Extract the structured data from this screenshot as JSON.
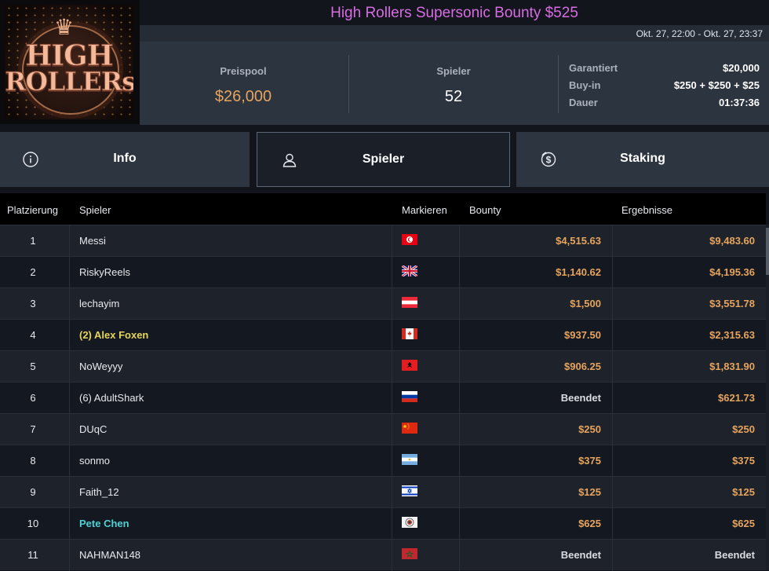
{
  "logo": {
    "line1": "HIGH",
    "line2": "ROLLERs"
  },
  "tournament": {
    "title": "High Rollers Supersonic Bounty $525",
    "dates": "Okt. 27, 22:00 - Okt. 27, 23:37"
  },
  "stats": {
    "pool_label": "Preispool",
    "pool_value": "$26,000",
    "players_label": "Spieler",
    "players_value": "52",
    "info": [
      {
        "key": "Garantiert",
        "value": "$20,000"
      },
      {
        "key": "Buy-in",
        "value": "$250 + $250 + $25"
      },
      {
        "key": "Dauer",
        "value": "01:37:36"
      }
    ]
  },
  "tabs": [
    {
      "label": "Info",
      "icon": "info-icon",
      "active": false
    },
    {
      "label": "Spieler",
      "icon": "user-icon",
      "active": true
    },
    {
      "label": "Staking",
      "icon": "dollar-coin-icon",
      "active": false
    }
  ],
  "table": {
    "headers": {
      "rank": "Platzierung",
      "player": "Spieler",
      "flag": "Markieren",
      "bounty": "Bounty",
      "result": "Ergebnisse"
    },
    "rows": [
      {
        "rank": "1",
        "player": "Messi",
        "flag": "tunisia",
        "bounty": "$4,515.63",
        "result": "$9,483.60"
      },
      {
        "rank": "2",
        "player": "RiskyReels",
        "flag": "uk",
        "bounty": "$1,140.62",
        "result": "$4,195.36"
      },
      {
        "rank": "3",
        "player": "lechayim",
        "flag": "austria",
        "bounty": "$1,500",
        "result": "$3,551.78"
      },
      {
        "rank": "4",
        "player": "(2) Alex Foxen",
        "flag": "canada",
        "bounty": "$937.50",
        "result": "$2,315.63",
        "highlight": "yellow"
      },
      {
        "rank": "5",
        "player": "NoWeyyy",
        "flag": "albania",
        "bounty": "$906.25",
        "result": "$1,831.90"
      },
      {
        "rank": "6",
        "player": "(6) AdultShark",
        "flag": "russia",
        "bounty": "Beendet",
        "result": "$621.73"
      },
      {
        "rank": "7",
        "player": "DUqC",
        "flag": "china",
        "bounty": "$250",
        "result": "$250"
      },
      {
        "rank": "8",
        "player": "sonmo",
        "flag": "argentina",
        "bounty": "$375",
        "result": "$375"
      },
      {
        "rank": "9",
        "player": "Faith_12",
        "flag": "israel",
        "bounty": "$125",
        "result": "$125"
      },
      {
        "rank": "10",
        "player": "Pete Chen",
        "flag": "emblem",
        "bounty": "$625",
        "result": "$625",
        "highlight": "teal"
      },
      {
        "rank": "11",
        "player": "NAHMAN148",
        "flag": "morocco",
        "bounty": "Beendet",
        "result": "Beendet"
      }
    ]
  },
  "colors": {
    "accent_title": "#d86ce2",
    "money": "#e6a45d",
    "highlight_yellow": "#e6d55a",
    "highlight_teal": "#4fd0d3"
  }
}
